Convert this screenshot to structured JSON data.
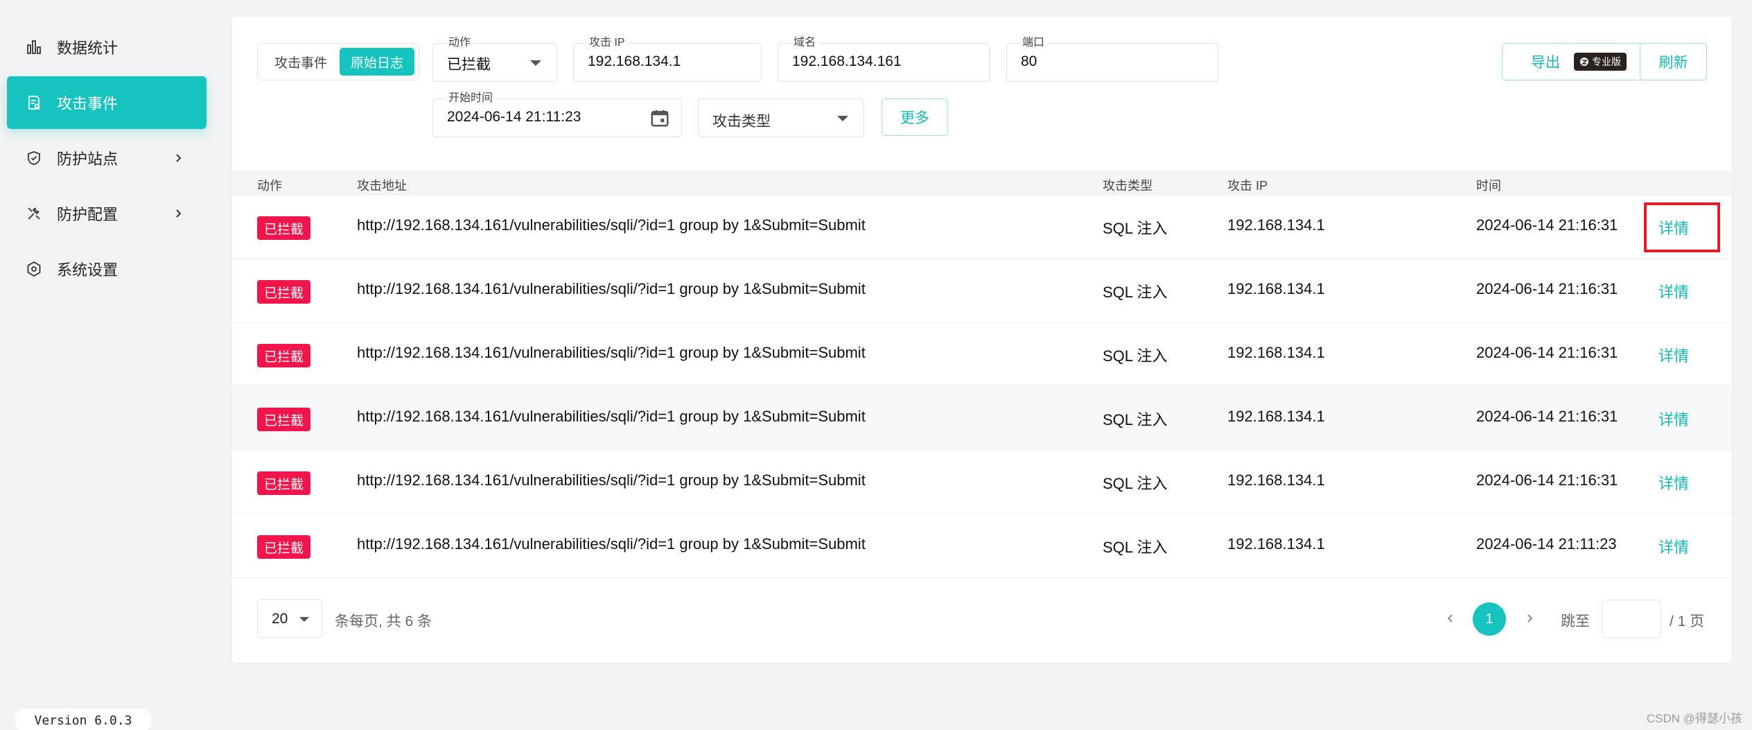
{
  "sidebar": {
    "items": [
      {
        "label": "数据统计",
        "icon": "bar-chart-icon"
      },
      {
        "label": "攻击事件",
        "icon": "document-icon"
      },
      {
        "label": "防护站点",
        "icon": "shield-icon"
      },
      {
        "label": "防护配置",
        "icon": "tools-icon"
      },
      {
        "label": "系统设置",
        "icon": "gear-icon"
      }
    ],
    "version": "Version 6.0.3"
  },
  "filters": {
    "segment": {
      "options": [
        "攻击事件",
        "原始日志"
      ],
      "selected": "原始日志"
    },
    "action": {
      "label": "动作",
      "value": "已拦截"
    },
    "ip": {
      "label": "攻击 IP",
      "value": "192.168.134.1"
    },
    "domain": {
      "label": "域名",
      "value": "192.168.134.161"
    },
    "port": {
      "label": "端口",
      "value": "80"
    },
    "start_time": {
      "label": "开始时间",
      "value": "2024-06-14 21:11:23"
    },
    "attack_type": {
      "placeholder": "攻击类型"
    },
    "more_label": "更多",
    "export_label": "导出",
    "pro_badge": "专业版",
    "refresh_label": "刷新"
  },
  "table": {
    "headers": [
      "动作",
      "攻击地址",
      "攻击类型",
      "攻击 IP",
      "时间"
    ],
    "rows": [
      {
        "action": "已拦截",
        "url": "http://192.168.134.161/vulnerabilities/sqli/?id=1 group by 1&Submit=Submit",
        "type": "SQL 注入",
        "ip": "192.168.134.1",
        "time": "2024-06-14 21:16:31",
        "detail": "详情"
      },
      {
        "action": "已拦截",
        "url": "http://192.168.134.161/vulnerabilities/sqli/?id=1 group by 1&Submit=Submit",
        "type": "SQL 注入",
        "ip": "192.168.134.1",
        "time": "2024-06-14 21:16:31",
        "detail": "详情"
      },
      {
        "action": "已拦截",
        "url": "http://192.168.134.161/vulnerabilities/sqli/?id=1 group by 1&Submit=Submit",
        "type": "SQL 注入",
        "ip": "192.168.134.1",
        "time": "2024-06-14 21:16:31",
        "detail": "详情"
      },
      {
        "action": "已拦截",
        "url": "http://192.168.134.161/vulnerabilities/sqli/?id=1 group by 1&Submit=Submit",
        "type": "SQL 注入",
        "ip": "192.168.134.1",
        "time": "2024-06-14 21:16:31",
        "detail": "详情"
      },
      {
        "action": "已拦截",
        "url": "http://192.168.134.161/vulnerabilities/sqli/?id=1 group by 1&Submit=Submit",
        "type": "SQL 注入",
        "ip": "192.168.134.1",
        "time": "2024-06-14 21:16:31",
        "detail": "详情"
      },
      {
        "action": "已拦截",
        "url": "http://192.168.134.161/vulnerabilities/sqli/?id=1 group by 1&Submit=Submit",
        "type": "SQL 注入",
        "ip": "192.168.134.1",
        "time": "2024-06-14 21:11:23",
        "detail": "详情"
      }
    ]
  },
  "pagination": {
    "page_size": "20",
    "summary": "条每页, 共 6 条",
    "current_page": "1",
    "jump_label": "跳至",
    "total_pages": "/ 1 页"
  },
  "watermark": "CSDN @得瑟小孩",
  "colors": {
    "accent": "#17c3be",
    "danger": "#f0154a",
    "highlight_box": "#e11d2a"
  }
}
